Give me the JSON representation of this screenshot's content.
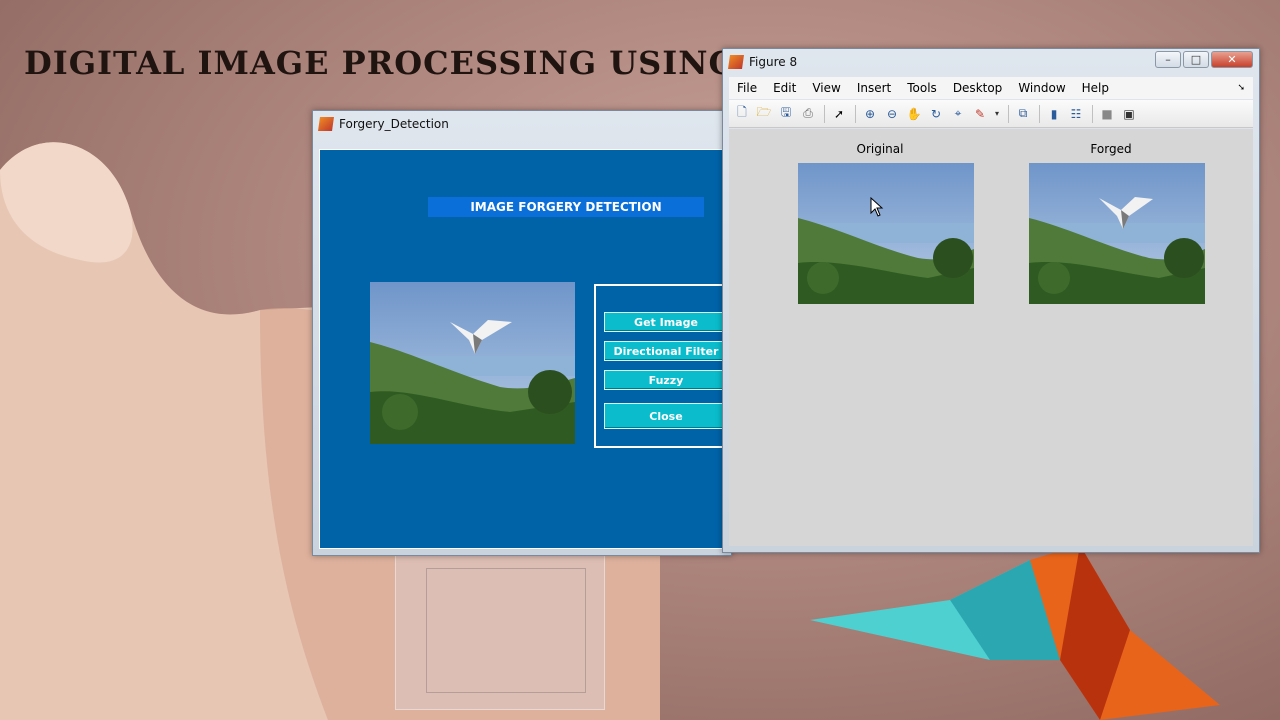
{
  "background": {
    "banner": "DIGITAL IMAGE PROCESSING USING MATLAB PROJECTS"
  },
  "forgery_window": {
    "title": "Forgery_Detection",
    "heading": "IMAGE FORGERY DETECTION",
    "buttons": [
      "Get Image",
      "Directional Filter",
      "Fuzzy",
      "Close"
    ]
  },
  "figure_window": {
    "title": "Figure 8",
    "menus": [
      "File",
      "Edit",
      "View",
      "Insert",
      "Tools",
      "Desktop",
      "Window",
      "Help"
    ],
    "toolbar_icons": [
      "new-icon",
      "open-icon",
      "save-icon",
      "print-icon",
      "pointer-icon",
      "zoom-in-icon",
      "zoom-out-icon",
      "pan-icon",
      "rotate-icon",
      "data-cursor-icon",
      "brush-icon",
      "link-icon",
      "colorbar-icon",
      "legend-icon",
      "hide-tools-icon",
      "show-tools-icon"
    ],
    "axes": [
      {
        "title": "Original"
      },
      {
        "title": "Forged"
      }
    ]
  },
  "colors": {
    "gui_bg": "#0063a8",
    "button_bg": "#0abccc",
    "heading_bg": "#0a6fd8",
    "figure_bg": "#d6d6d6"
  }
}
